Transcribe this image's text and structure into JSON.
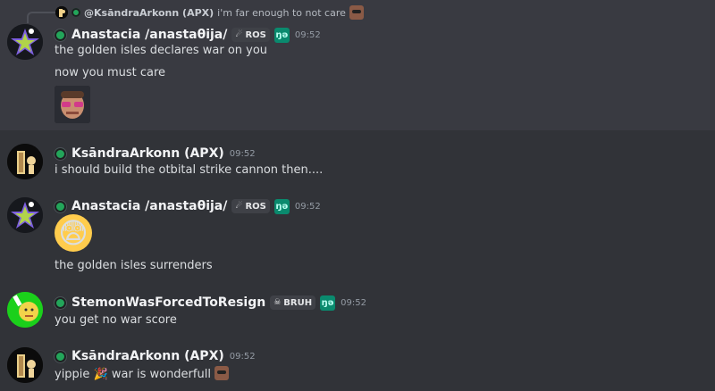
{
  "reply": {
    "author": "@KsāndraArkonn (APX)",
    "text": "i'm far enough to not care"
  },
  "messages": [
    {
      "author": "Anastacia /anastaθija/",
      "tag": "ROS",
      "badge": "ŋə",
      "time": "09:52",
      "lines": [
        "the golden isles declares war on you",
        "now you must care"
      ]
    },
    {
      "author": "KsāndraArkonn (APX)",
      "time": "09:52",
      "lines": [
        "i should build the otbital strike cannon then...."
      ]
    },
    {
      "author": "Anastacia /anastaθija/",
      "tag": "ROS",
      "badge": "ŋə",
      "time": "09:52",
      "emoji": "😨",
      "lines": [
        "the golden isles surrenders"
      ]
    },
    {
      "author": "StemonWasForcedToResign",
      "tag": "BRUH",
      "badge": "ŋə",
      "time": "09:52",
      "lines": [
        "you get no war score"
      ]
    },
    {
      "author": "KsāndraArkonn (APX)",
      "time": "09:52",
      "line_parts": [
        "yippie",
        "war is wonderfull"
      ],
      "party_emoji": "🎉"
    }
  ],
  "colors": {
    "background": "#313338",
    "online": "#23a55a",
    "badge": "#0a8a6e"
  }
}
